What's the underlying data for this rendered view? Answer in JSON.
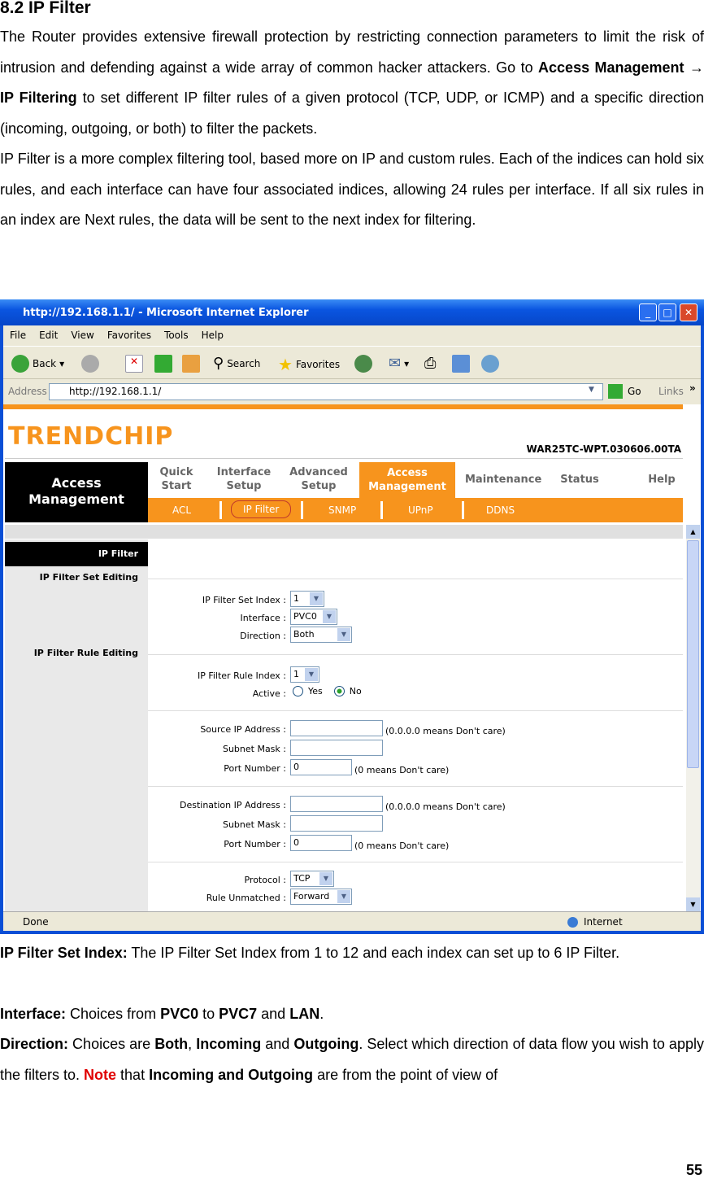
{
  "doc": {
    "heading": "8.2 IP Filter",
    "p1a": "The Router provides extensive firewall protection by restricting connection parameters to limit the risk of intrusion and defending against a wide array of common hacker attackers. Go to ",
    "p1b": "Access Management",
    "p1arrow": " → ",
    "p1c": "IP Filtering",
    "p1d": " to set different IP filter rules of a given protocol (TCP, UDP, or ICMP) and a specific direction (incoming, outgoing, or both) to filter the packets.",
    "p2": "IP Filter is a more complex filtering tool, based more on IP and custom rules. Each of the indices can hold six rules, and each interface can have four associated indices, allowing 24 rules per interface. If all six rules in an index are Next rules, the data will be sent to the next index for filtering.",
    "d1_label": "IP Filter Set Index:",
    "d1_text": " The IP Filter Set Index from 1 to 12 and each index can set up to 6 IP Filter.",
    "d2_label": "Interface:",
    "d2_a": " Choices from ",
    "d2_b": "PVC0",
    "d2_c": " to ",
    "d2_d": "PVC7",
    "d2_e": " and ",
    "d2_f": "LAN",
    "d2_g": ".",
    "d3_label": "Direction:",
    "d3_a": " Choices are ",
    "d3_b": "Both",
    "d3_c": ", ",
    "d3_d": "Incoming",
    "d3_e": " and ",
    "d3_f": "Outgoing",
    "d3_g": ". Select which direction of data flow you wish to apply the filters to. ",
    "d3_note": "Note",
    "d3_h": " that ",
    "d3_i": "Incoming and Outgoing",
    "d3_j": " are from the point of view of",
    "page_number": "55"
  },
  "browser": {
    "title": "http://192.168.1.1/ - Microsoft Internet Explorer",
    "menu": [
      "File",
      "Edit",
      "View",
      "Favorites",
      "Tools",
      "Help"
    ],
    "toolbar": {
      "back": "Back",
      "search": "Search",
      "favorites": "Favorites"
    },
    "address_label": "Address",
    "address": "http://192.168.1.1/",
    "go": "Go",
    "links": "Links",
    "status": "Done",
    "zone": "Internet"
  },
  "router": {
    "logo": "TRENDCHIP",
    "firmware": "WAR25TC-WPT.030606.00TA",
    "section": "Access Management",
    "tabs": [
      "Quick Start",
      "Interface Setup",
      "Advanced Setup",
      "Access Management",
      "Maintenance",
      "Status",
      "Help"
    ],
    "subtabs": [
      "ACL",
      "IP Filter",
      "SNMP",
      "UPnP",
      "DDNS"
    ],
    "left": {
      "title": "IP Filter",
      "set_editing": "IP Filter Set Editing",
      "rule_editing": "IP Filter Rule Editing"
    },
    "form": {
      "set_index_label": "IP Filter Set Index :",
      "set_index": "1",
      "interface_label": "Interface :",
      "interface": "PVC0",
      "direction_label": "Direction :",
      "direction": "Both",
      "rule_index_label": "IP Filter Rule Index :",
      "rule_index": "1",
      "active_label": "Active :",
      "yes": "Yes",
      "no": "No",
      "active": "No",
      "src_ip_label": "Source IP Address :",
      "src_ip": "",
      "src_hint": "(0.0.0.0 means Don't care)",
      "src_mask_label": "Subnet Mask :",
      "src_mask": "",
      "src_port_label": "Port Number :",
      "src_port": "0",
      "port_hint": "(0 means Don't care)",
      "dst_ip_label": "Destination IP Address :",
      "dst_ip": "",
      "dst_hint": "(0.0.0.0 means Don't care)",
      "dst_mask_label": "Subnet Mask :",
      "dst_mask": "",
      "dst_port_label": "Port Number :",
      "dst_port": "0",
      "dst_port_hint": "(0 means Don't care)",
      "protocol_label": "Protocol :",
      "protocol": "TCP",
      "unmatched_label": "Rule Unmatched :",
      "unmatched": "Forward"
    }
  }
}
